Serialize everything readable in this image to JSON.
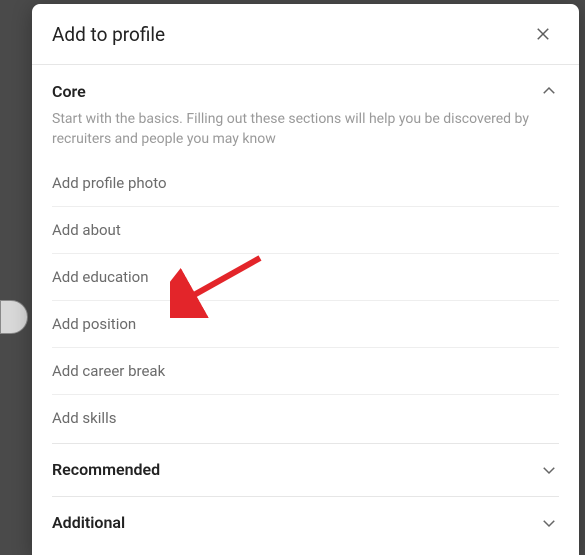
{
  "modal": {
    "title": "Add to profile"
  },
  "sections": {
    "core": {
      "title": "Core",
      "description": "Start with the basics. Filling out these sections will help you be discovered by recruiters and people you may know",
      "items": [
        "Add profile photo",
        "Add about",
        "Add education",
        "Add position",
        "Add career break",
        "Add skills"
      ]
    },
    "recommended": {
      "title": "Recommended"
    },
    "additional": {
      "title": "Additional"
    }
  }
}
